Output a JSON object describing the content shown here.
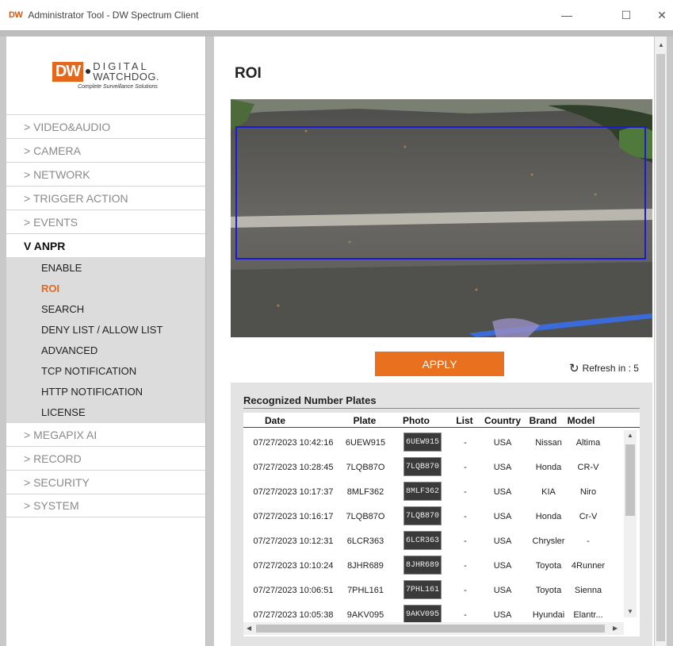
{
  "window": {
    "app_logo": "DW",
    "title": "Administrator Tool - DW Spectrum Client",
    "min_glyph": "—",
    "max_glyph": "☐",
    "close_glyph": "✕"
  },
  "logo": {
    "mark": "DW",
    "line1": "DIGITAL",
    "line2": "WATCHDOG.",
    "tagline": "Complete Surveillance Solutions"
  },
  "sidebar": {
    "top_items": [
      "> VIDEO&AUDIO",
      "> CAMERA",
      "> NETWORK",
      "> TRIGGER ACTION",
      "> EVENTS"
    ],
    "active_item": "V ANPR",
    "sub_items": [
      "ENABLE",
      "ROI",
      "SEARCH",
      "DENY LIST / ALLOW LIST",
      "ADVANCED",
      "TCP NOTIFICATION",
      "HTTP NOTIFICATION",
      "LICENSE"
    ],
    "bottom_items": [
      "> MEGAPIX AI",
      "> RECORD",
      "> SECURITY",
      "> SYSTEM"
    ]
  },
  "main": {
    "title": "ROI",
    "apply_label": "APPLY",
    "refresh_icon": "↻",
    "refresh_label": "Refresh in : 5"
  },
  "plates": {
    "title": "Recognized Number Plates",
    "columns": [
      "Date",
      "Plate",
      "Photo",
      "List",
      "Country",
      "Brand",
      "Model"
    ],
    "rows": [
      {
        "date": "07/27/2023 10:42:16",
        "plate": "6UEW915",
        "photo": "6UEW915",
        "list": "-",
        "country": "USA",
        "brand": "Nissan",
        "model": "Altima"
      },
      {
        "date": "07/27/2023 10:28:45",
        "plate": "7LQB87O",
        "photo": "7LQB870",
        "list": "-",
        "country": "USA",
        "brand": "Honda",
        "model": "CR-V"
      },
      {
        "date": "07/27/2023 10:17:37",
        "plate": "8MLF362",
        "photo": "8MLF362",
        "list": "-",
        "country": "USA",
        "brand": "KIA",
        "model": "Niro"
      },
      {
        "date": "07/27/2023 10:16:17",
        "plate": "7LQB87O",
        "photo": "7LQB870",
        "list": "-",
        "country": "USA",
        "brand": "Honda",
        "model": "Cr-V"
      },
      {
        "date": "07/27/2023 10:12:31",
        "plate": "6LCR363",
        "photo": "6LCR363",
        "list": "-",
        "country": "USA",
        "brand": "Chrysler",
        "model": "-"
      },
      {
        "date": "07/27/2023 10:10:24",
        "plate": "8JHR689",
        "photo": "8JHR689",
        "list": "-",
        "country": "USA",
        "brand": "Toyota",
        "model": "4Runner"
      },
      {
        "date": "07/27/2023 10:06:51",
        "plate": "7PHL161",
        "photo": "7PHL161",
        "list": "-",
        "country": "USA",
        "brand": "Toyota",
        "model": "Sienna"
      },
      {
        "date": "07/27/2023 10:05:38",
        "plate": "9AKV095",
        "photo": "9AKV095",
        "list": "-",
        "country": "USA",
        "brand": "Hyundai",
        "model": "Elantr..."
      }
    ]
  }
}
